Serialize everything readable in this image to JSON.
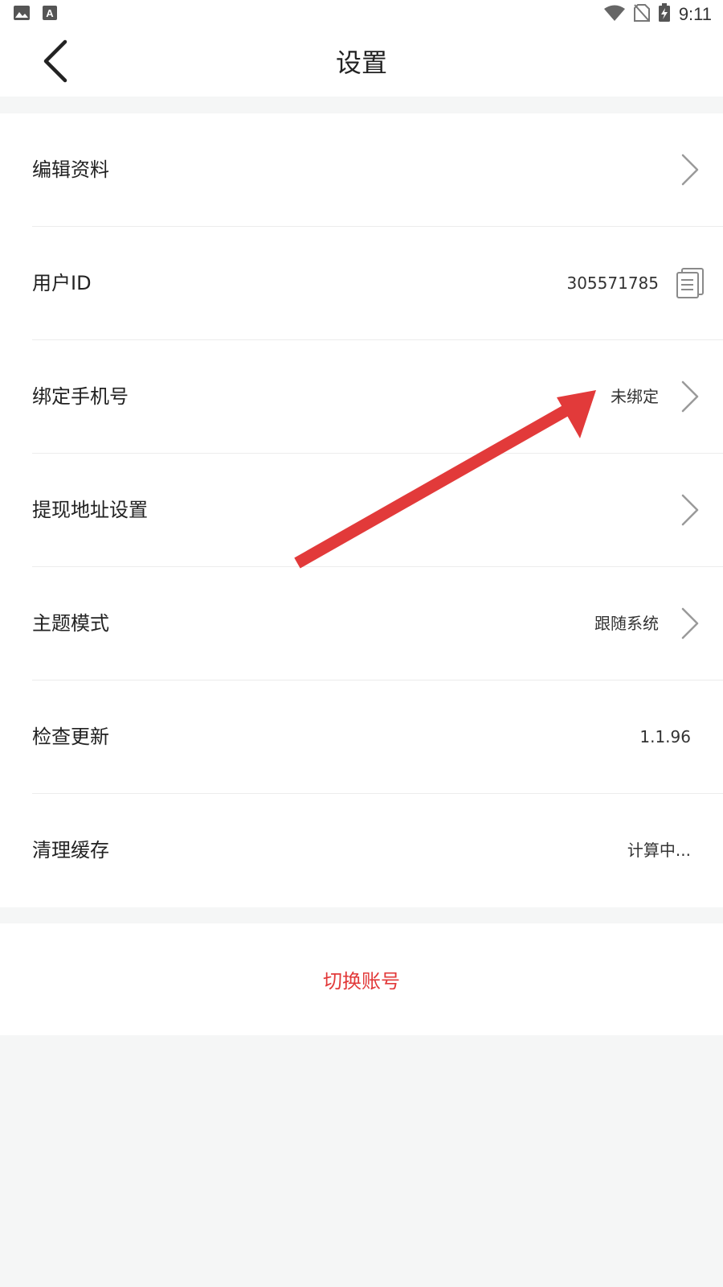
{
  "status_bar": {
    "time": "9:11",
    "left_icons": [
      "gallery-icon",
      "text-a-icon"
    ],
    "right_icons": [
      "wifi-icon",
      "no-sim-icon",
      "battery-charging-icon"
    ]
  },
  "header": {
    "title": "设置",
    "back_icon": "chevron-left-icon"
  },
  "settings": {
    "edit_profile": {
      "label": "编辑资料"
    },
    "user_id": {
      "label": "用户ID",
      "value": "305571785",
      "icon": "copy-icon"
    },
    "bind_phone": {
      "label": "绑定手机号",
      "value": "未绑定"
    },
    "withdraw_address": {
      "label": "提现地址设置"
    },
    "theme_mode": {
      "label": "主题模式",
      "value": "跟随系统"
    },
    "check_update": {
      "label": "检查更新",
      "value": "1.1.96"
    },
    "clear_cache": {
      "label": "清理缓存",
      "value": "计算中..."
    }
  },
  "switch_account": {
    "label": "切换账号"
  },
  "colors": {
    "accent_red": "#e23a3a",
    "background": "#f5f6f6",
    "card": "#ffffff",
    "chevron": "#9a9a9a",
    "annotation_arrow": "#e23a3a"
  }
}
